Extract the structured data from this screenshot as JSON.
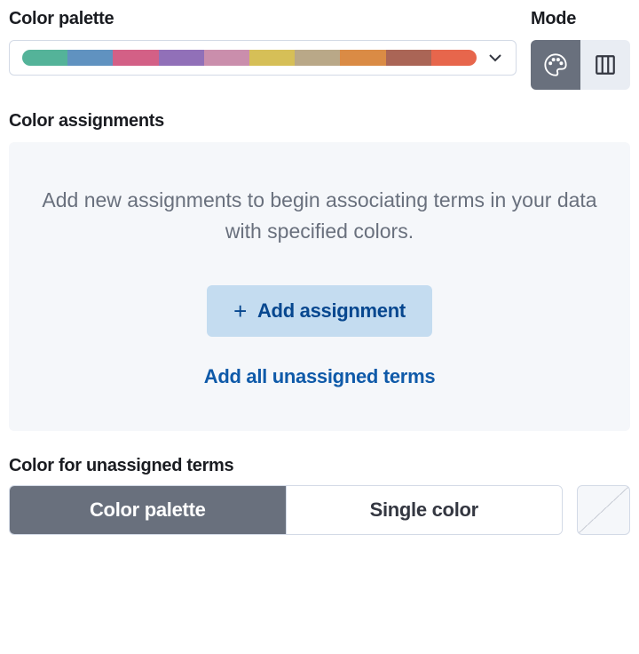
{
  "palette": {
    "label": "Color palette",
    "colors": [
      "#54b399",
      "#6092c0",
      "#d36086",
      "#9170b8",
      "#ca8eac",
      "#d6bf57",
      "#b9a888",
      "#da8b45",
      "#aa6556",
      "#e7664c"
    ]
  },
  "mode": {
    "label": "Mode"
  },
  "assignments": {
    "label": "Color assignments",
    "empty_text": "Add new assignments to begin associating terms in your data with specified colors.",
    "add_label": "Add assignment",
    "add_all_label": "Add all unassigned terms"
  },
  "unassigned": {
    "label": "Color for unassigned terms",
    "option_palette": "Color palette",
    "option_single": "Single color"
  }
}
